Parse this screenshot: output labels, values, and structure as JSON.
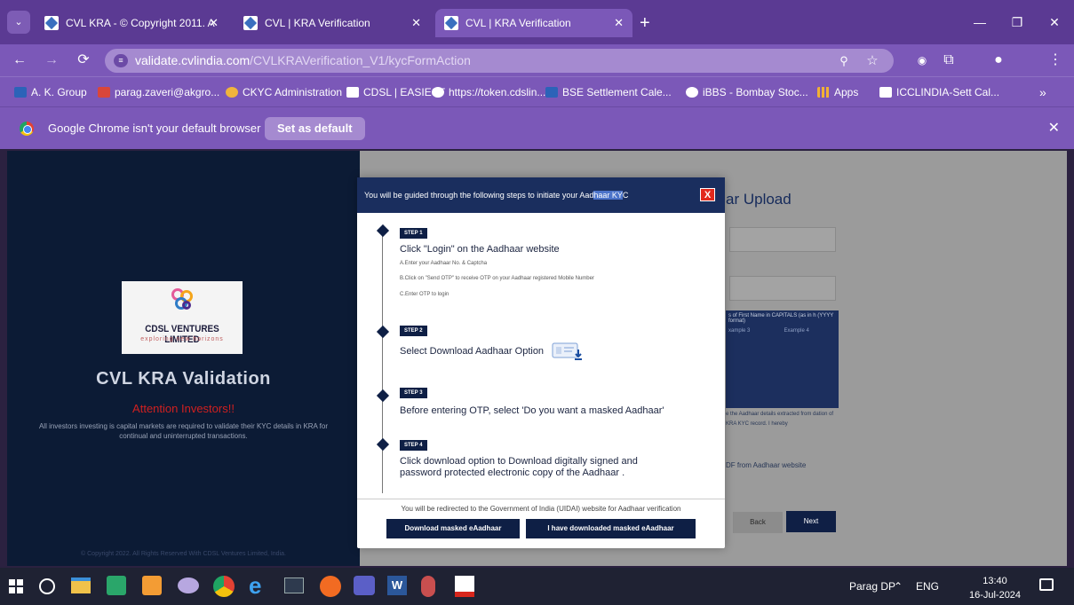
{
  "browser": {
    "tabs": [
      {
        "title": "CVL KRA - © Copyright 2011. A",
        "active": false
      },
      {
        "title": "CVL | KRA Verification",
        "active": false
      },
      {
        "title": "CVL | KRA Verification",
        "active": true
      }
    ],
    "url_host": "validate.cvlindia.com",
    "url_path": "/CVLKRAVerification_V1/kycFormAction",
    "bookmarks": [
      "A. K. Group",
      "parag.zaveri@akgro...",
      "CKYC Administration",
      "CDSL | EASIEST",
      "https://token.cdslin...",
      "BSE Settlement Cale...",
      "iBBS - Bombay Stoc...",
      "Apps",
      "ICCLINDIA-Sett Cal..."
    ],
    "infobar": {
      "message": "Google Chrome isn't your default browser",
      "button": "Set as default"
    }
  },
  "left_panel": {
    "logo_name": "CDSL VENTURES LIMITED",
    "logo_tagline": "exploring new horizons",
    "title": "CVL KRA Validation",
    "attention": "Attention Investors!!",
    "description": "All investors investing is capital markets are required to validate their KYC details in KRA for continual and uninterrupted transactions.",
    "copyright": "© Copyright 2022. All Rights Reserved With CDSL Ventures Limited, India."
  },
  "right_form": {
    "title_fragment": "ar Upload",
    "table_head": "s of First Name in CAPITALS (as in h (YYYY format)",
    "example_col1": "xample 3",
    "example_col2": "Example 4",
    "note_fragment": "e the Aadhaar details extracted from dation of KRA KYC record. I hereby",
    "pdf_fragment": "DF from Aadhaar website",
    "back_label": "Back",
    "next_label": "Next"
  },
  "modal": {
    "title_pre": "You will be guided through the following steps to initiate your Aad",
    "title_highlight": "haar KY",
    "title_post": "C",
    "close": "X",
    "steps": [
      {
        "badge": "STEP 1",
        "heading": "Click \"Login\" on the Aadhaar website",
        "sub": [
          "A.Enter your Aadhaar No. & Captcha",
          "B.Click on \"Send OTP\" to receive OTP on your Aadhaar registered Mobile Number",
          "C.Enter OTP to login"
        ]
      },
      {
        "badge": "STEP 2",
        "heading": "Select Download Aadhaar Option"
      },
      {
        "badge": "STEP 3",
        "heading": "Before entering OTP, select 'Do you want a masked Aadhaar'"
      },
      {
        "badge": "STEP 4",
        "heading": "Click download option to Download digitally signed and",
        "heading2": "password protected electronic copy of the Aadhaar ."
      }
    ],
    "footer_note": "You will be redirected to the Government of India (UIDAI) website for Aadhaar verification",
    "button_download": "Download masked eAadhaar",
    "button_downloaded": "I have downloaded masked eAadhaar"
  },
  "taskbar": {
    "user": "Parag DP",
    "lang": "ENG",
    "time": "13:40",
    "date": "16-Jul-2024"
  }
}
